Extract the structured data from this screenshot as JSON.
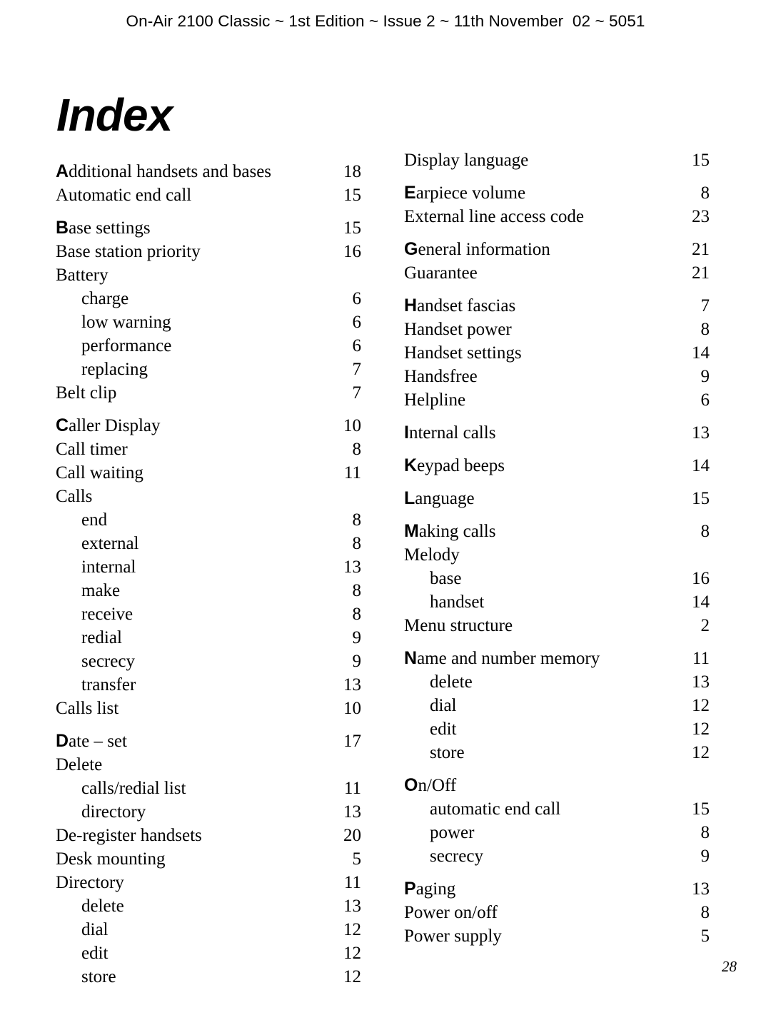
{
  "header": {
    "text": "On-Air 2100 Classic ~ 1st Edition ~ Issue 2 ~ 11th November  02 ~ 5051"
  },
  "title": "Index",
  "folio": "28",
  "columns": [
    {
      "name": "left",
      "entries": [
        {
          "initial": "A",
          "rest": "dditional handsets and bases",
          "page": "18",
          "sub": false,
          "section_start": true
        },
        {
          "initial": "",
          "rest": "Automatic end call",
          "page": "15",
          "sub": false,
          "section_start": false
        },
        {
          "initial": "B",
          "rest": "ase settings",
          "page": "15",
          "sub": false,
          "section_start": true
        },
        {
          "initial": "",
          "rest": "Base station priority",
          "page": "16",
          "sub": false,
          "section_start": false
        },
        {
          "initial": "",
          "rest": "Battery",
          "page": "",
          "sub": false,
          "section_start": false
        },
        {
          "initial": "",
          "rest": "charge",
          "page": "6",
          "sub": true,
          "section_start": false
        },
        {
          "initial": "",
          "rest": "low warning",
          "page": "6",
          "sub": true,
          "section_start": false
        },
        {
          "initial": "",
          "rest": "performance",
          "page": "6",
          "sub": true,
          "section_start": false
        },
        {
          "initial": "",
          "rest": "replacing",
          "page": "7",
          "sub": true,
          "section_start": false
        },
        {
          "initial": "",
          "rest": "Belt clip",
          "page": "7",
          "sub": false,
          "section_start": false
        },
        {
          "initial": "C",
          "rest": "aller Display",
          "page": "10",
          "sub": false,
          "section_start": true
        },
        {
          "initial": "",
          "rest": "Call timer",
          "page": "8",
          "sub": false,
          "section_start": false
        },
        {
          "initial": "",
          "rest": "Call waiting",
          "page": "11",
          "sub": false,
          "section_start": false
        },
        {
          "initial": "",
          "rest": "Calls",
          "page": "",
          "sub": false,
          "section_start": false
        },
        {
          "initial": "",
          "rest": "end",
          "page": "8",
          "sub": true,
          "section_start": false
        },
        {
          "initial": "",
          "rest": "external",
          "page": "8",
          "sub": true,
          "section_start": false
        },
        {
          "initial": "",
          "rest": "internal",
          "page": "13",
          "sub": true,
          "section_start": false
        },
        {
          "initial": "",
          "rest": "make",
          "page": "8",
          "sub": true,
          "section_start": false
        },
        {
          "initial": "",
          "rest": "receive",
          "page": "8",
          "sub": true,
          "section_start": false
        },
        {
          "initial": "",
          "rest": "redial",
          "page": "9",
          "sub": true,
          "section_start": false
        },
        {
          "initial": "",
          "rest": "secrecy",
          "page": "9",
          "sub": true,
          "section_start": false
        },
        {
          "initial": "",
          "rest": "transfer",
          "page": "13",
          "sub": true,
          "section_start": false
        },
        {
          "initial": "",
          "rest": "Calls list",
          "page": "10",
          "sub": false,
          "section_start": false
        },
        {
          "initial": "D",
          "rest": "ate – set",
          "page": "17",
          "sub": false,
          "section_start": true
        },
        {
          "initial": "",
          "rest": "Delete",
          "page": "",
          "sub": false,
          "section_start": false
        },
        {
          "initial": "",
          "rest": "calls/redial list",
          "page": "11",
          "sub": true,
          "section_start": false
        },
        {
          "initial": "",
          "rest": "directory",
          "page": "13",
          "sub": true,
          "section_start": false
        },
        {
          "initial": "",
          "rest": "De-register handsets",
          "page": "20",
          "sub": false,
          "section_start": false
        },
        {
          "initial": "",
          "rest": "Desk mounting",
          "page": "5",
          "sub": false,
          "section_start": false
        },
        {
          "initial": "",
          "rest": "Directory",
          "page": "11",
          "sub": false,
          "section_start": false
        },
        {
          "initial": "",
          "rest": "delete",
          "page": "13",
          "sub": true,
          "section_start": false
        },
        {
          "initial": "",
          "rest": "dial",
          "page": "12",
          "sub": true,
          "section_start": false
        },
        {
          "initial": "",
          "rest": "edit",
          "page": "12",
          "sub": true,
          "section_start": false
        },
        {
          "initial": "",
          "rest": "store",
          "page": "12",
          "sub": true,
          "section_start": false
        }
      ]
    },
    {
      "name": "right",
      "entries": [
        {
          "initial": "",
          "rest": "Display language",
          "page": "15",
          "sub": false,
          "section_start": true
        },
        {
          "initial": "E",
          "rest": "arpiece volume",
          "page": "8",
          "sub": false,
          "section_start": true
        },
        {
          "initial": "",
          "rest": "External line access code",
          "page": "23",
          "sub": false,
          "section_start": false
        },
        {
          "initial": "G",
          "rest": "eneral information",
          "page": "21",
          "sub": false,
          "section_start": true
        },
        {
          "initial": "",
          "rest": "Guarantee",
          "page": "21",
          "sub": false,
          "section_start": false
        },
        {
          "initial": "H",
          "rest": "andset fascias",
          "page": "7",
          "sub": false,
          "section_start": true
        },
        {
          "initial": "",
          "rest": "Handset power",
          "page": "8",
          "sub": false,
          "section_start": false
        },
        {
          "initial": "",
          "rest": "Handset settings",
          "page": "14",
          "sub": false,
          "section_start": false
        },
        {
          "initial": "",
          "rest": "Handsfree",
          "page": "9",
          "sub": false,
          "section_start": false
        },
        {
          "initial": "",
          "rest": "Helpline",
          "page": "6",
          "sub": false,
          "section_start": false
        },
        {
          "initial": "I",
          "rest": "nternal calls",
          "page": "13",
          "sub": false,
          "section_start": true
        },
        {
          "initial": "K",
          "rest": "eypad beeps",
          "page": "14",
          "sub": false,
          "section_start": true
        },
        {
          "initial": "L",
          "rest": "anguage",
          "page": "15",
          "sub": false,
          "section_start": true
        },
        {
          "initial": "M",
          "rest": "aking calls",
          "page": "8",
          "sub": false,
          "section_start": true
        },
        {
          "initial": "",
          "rest": "Melody",
          "page": "",
          "sub": false,
          "section_start": false
        },
        {
          "initial": "",
          "rest": "base",
          "page": "16",
          "sub": true,
          "section_start": false
        },
        {
          "initial": "",
          "rest": "handset",
          "page": "14",
          "sub": true,
          "section_start": false
        },
        {
          "initial": "",
          "rest": "Menu structure",
          "page": "2",
          "sub": false,
          "section_start": false
        },
        {
          "initial": "N",
          "rest": "ame and number memory",
          "page": "11",
          "sub": false,
          "section_start": true
        },
        {
          "initial": "",
          "rest": "delete",
          "page": "13",
          "sub": true,
          "section_start": false
        },
        {
          "initial": "",
          "rest": "dial",
          "page": "12",
          "sub": true,
          "section_start": false
        },
        {
          "initial": "",
          "rest": "edit",
          "page": "12",
          "sub": true,
          "section_start": false
        },
        {
          "initial": "",
          "rest": "store",
          "page": "12",
          "sub": true,
          "section_start": false
        },
        {
          "initial": "O",
          "rest": "n/Off",
          "page": "",
          "sub": false,
          "section_start": true
        },
        {
          "initial": "",
          "rest": "automatic end call",
          "page": "15",
          "sub": true,
          "section_start": false
        },
        {
          "initial": "",
          "rest": "power",
          "page": "8",
          "sub": true,
          "section_start": false
        },
        {
          "initial": "",
          "rest": "secrecy",
          "page": "9",
          "sub": true,
          "section_start": false
        },
        {
          "initial": "P",
          "rest": "aging",
          "page": "13",
          "sub": false,
          "section_start": true
        },
        {
          "initial": "",
          "rest": "Power on/off",
          "page": "8",
          "sub": false,
          "section_start": false
        },
        {
          "initial": "",
          "rest": "Power supply",
          "page": "5",
          "sub": false,
          "section_start": false
        }
      ]
    }
  ]
}
